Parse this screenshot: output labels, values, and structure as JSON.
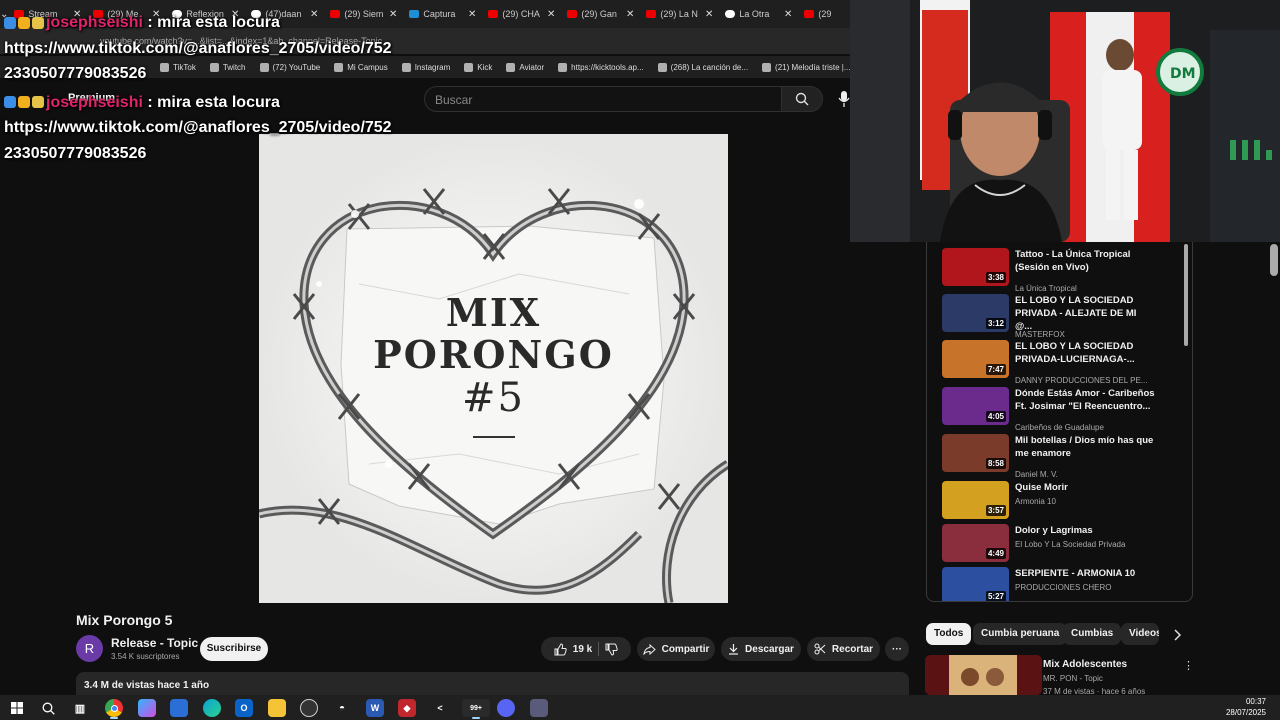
{
  "browser": {
    "tabs": [
      {
        "label": "Stream",
        "icon": "spotify-icon"
      },
      {
        "label": "(29) Me",
        "icon": "youtube-icon"
      },
      {
        "label": "Reflexion",
        "icon": "tiktok-icon"
      },
      {
        "label": "(47)daan",
        "icon": "tiktok-icon"
      },
      {
        "label": "(29) Siem",
        "icon": "youtube-icon"
      },
      {
        "label": "Captura",
        "icon": "photo-icon"
      },
      {
        "label": "(29) CHA",
        "icon": "youtube-icon"
      },
      {
        "label": "(29) Gan",
        "icon": "youtube-icon"
      },
      {
        "label": "(29) La N",
        "icon": "youtube-icon"
      },
      {
        "label": "La Otra",
        "icon": "tiktok-icon"
      },
      {
        "label": "(29",
        "icon": "youtube-icon"
      }
    ],
    "address": "youtube.com/watch?v=...&list=...&index=1&ab_channel=Release-Topic",
    "bookmarks": [
      "TikTok",
      "Twitch",
      "(72) YouTube",
      "Mi Campus",
      "Instagram",
      "Kick",
      "Aviator",
      "https://kicktools.ap...",
      "(268) La canción de...",
      "(21) Melodía triste |..."
    ]
  },
  "header": {
    "premium_label": "Premium",
    "search_placeholder": "Buscar"
  },
  "chat": {
    "messages": [
      {
        "user": "josephseishi",
        "text": ": mira esta locura",
        "link_line1": "https://www.tiktok.com/@anaflores_2705/video/752",
        "link_line2": "2330507779083526"
      },
      {
        "user": "josephseishi",
        "text": ": mira esta locura",
        "link_line1": "https://www.tiktok.com/@anaflores_2705/video/752",
        "link_line2": "2330507779083526"
      }
    ]
  },
  "thumbnail": {
    "line1": "MIX",
    "line2": "PORONGO",
    "line3": "#5"
  },
  "video": {
    "title": "Mix Porongo 5",
    "channel_initial": "R",
    "channel": "Release - Topic",
    "subscribers": "3.54 K suscriptores",
    "subscribe_label": "Suscribirse",
    "likes": "19 k",
    "share_label": "Compartir",
    "download_label": "Descargar",
    "clip_label": "Recortar",
    "more_label": "···",
    "views_date": "3.4 M de vistas  hace 1 año"
  },
  "playlist": [
    {
      "title": "Tattoo - La Única Tropical (Sesión en Vivo)",
      "channel": "La Única Tropical",
      "duration": "3:38",
      "color": "#b0161c"
    },
    {
      "title": "EL LOBO Y LA SOCIEDAD PRIVADA - ALEJATE DE MI @...",
      "channel": "MASTERFOX",
      "duration": "3:12",
      "color": "#2b3a66"
    },
    {
      "title": "EL LOBO Y LA SOCIEDAD PRIVADA-LUCIERNAGA-...",
      "channel": "DANNY PRODUCCIONES DEL PE...",
      "duration": "7:47",
      "color": "#c8732a"
    },
    {
      "title": "Dónde Estás Amor - Caribeños Ft. Josimar \"El Reencuentro...",
      "channel": "Caribeños de Guadalupe",
      "duration": "4:05",
      "color": "#6a2b8c"
    },
    {
      "title": "Mil botellas / Dios mío has que me enamore",
      "channel": "Daniel M. V.",
      "duration": "8:58",
      "color": "#7a3b2a"
    },
    {
      "title": "Quise Morir",
      "channel": "Armonia 10",
      "duration": "3:57",
      "color": "#d4a020"
    },
    {
      "title": "Dolor y Lagrimas",
      "channel": "El Lobo Y La Sociedad Privada",
      "duration": "4:49",
      "color": "#8a2d3c"
    },
    {
      "title": "SERPIENTE - ARMONIA 10",
      "channel": "PRODUCCIONES CHERO",
      "duration": "5:27",
      "color": "#2c4fa0"
    }
  ],
  "chips": [
    "Todos",
    "Cumbia peruana",
    "Cumbias",
    "Videos"
  ],
  "next_video": {
    "title": "Mix Adolescentes",
    "channel": "MR. PON - Topic",
    "meta": "37 M de vistas · hace 6 años"
  },
  "taskbar": {
    "time": "00:37",
    "date": "28/07/2025",
    "badge": "99+"
  }
}
